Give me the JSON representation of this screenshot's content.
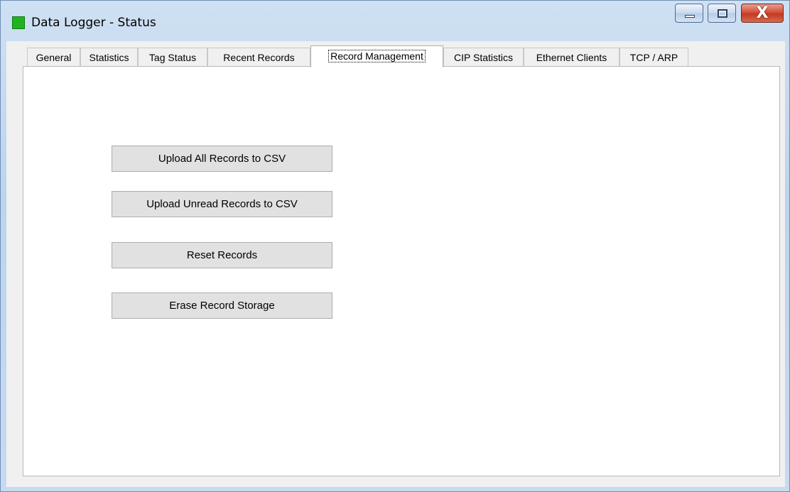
{
  "window": {
    "title": "Data Logger - Status",
    "close_glyph": "X",
    "icon": "green-square-icon"
  },
  "tabs": [
    {
      "label": "General",
      "active": false
    },
    {
      "label": "Statistics",
      "active": false
    },
    {
      "label": "Tag Status",
      "active": false
    },
    {
      "label": "Recent Records",
      "active": false
    },
    {
      "label": "Record Management",
      "active": true
    },
    {
      "label": "CIP Statistics",
      "active": false
    },
    {
      "label": "Ethernet Clients",
      "active": false
    },
    {
      "label": "TCP / ARP",
      "active": false
    }
  ],
  "record_management": {
    "upload_all_label": "Upload All Records to CSV",
    "upload_unread_label": "Upload Unread Records to CSV",
    "reset_label": "Reset Records",
    "erase_label": "Erase Record Storage"
  },
  "colors": {
    "app_icon": "#1fb41f",
    "close_button": "#c23a22",
    "title_bar": "#c6daf1"
  }
}
